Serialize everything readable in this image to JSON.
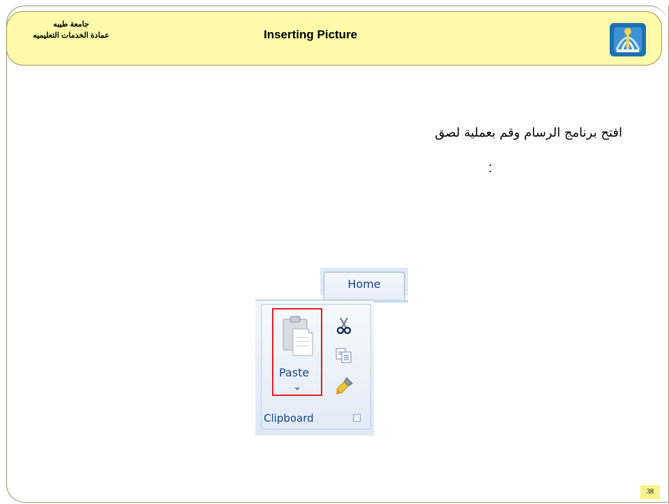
{
  "header": {
    "university_name": "جامعة طيبه",
    "deanship_name": "عمادة الخدمات التعليميه",
    "title": "Inserting Picture",
    "logo_icon": "university-logo-icon"
  },
  "content": {
    "instruction": "افتح برنامج الرسام وقم بعملية لصق",
    "colon": ":"
  },
  "ribbon": {
    "tab_label": "Home",
    "paste_label": "Paste",
    "group_label": "Clipboard",
    "icons": [
      "clipboard-paste-icon",
      "scissors-icon",
      "copy-icon",
      "format-painter-icon",
      "dialog-launcher-icon"
    ],
    "highlight_color": "#e31b23"
  },
  "footer": {
    "page_number": "38"
  },
  "colors": {
    "header_bg": "#fdfbaa",
    "ribbon_text": "#15428b",
    "page_number_bg": "#f5f38b"
  }
}
